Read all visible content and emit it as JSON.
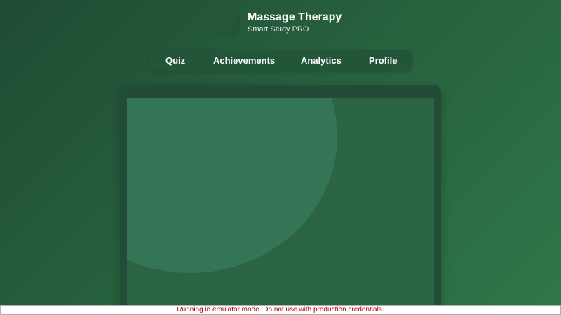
{
  "header": {
    "title": "Massage Therapy",
    "subtitle": "Smart Study PRO"
  },
  "nav": {
    "items": [
      {
        "label": "Quiz"
      },
      {
        "label": "Achievements"
      },
      {
        "label": "Analytics"
      },
      {
        "label": "Profile"
      }
    ]
  },
  "banner": {
    "text": "Running in emulator mode. Do not use with production credentials."
  }
}
